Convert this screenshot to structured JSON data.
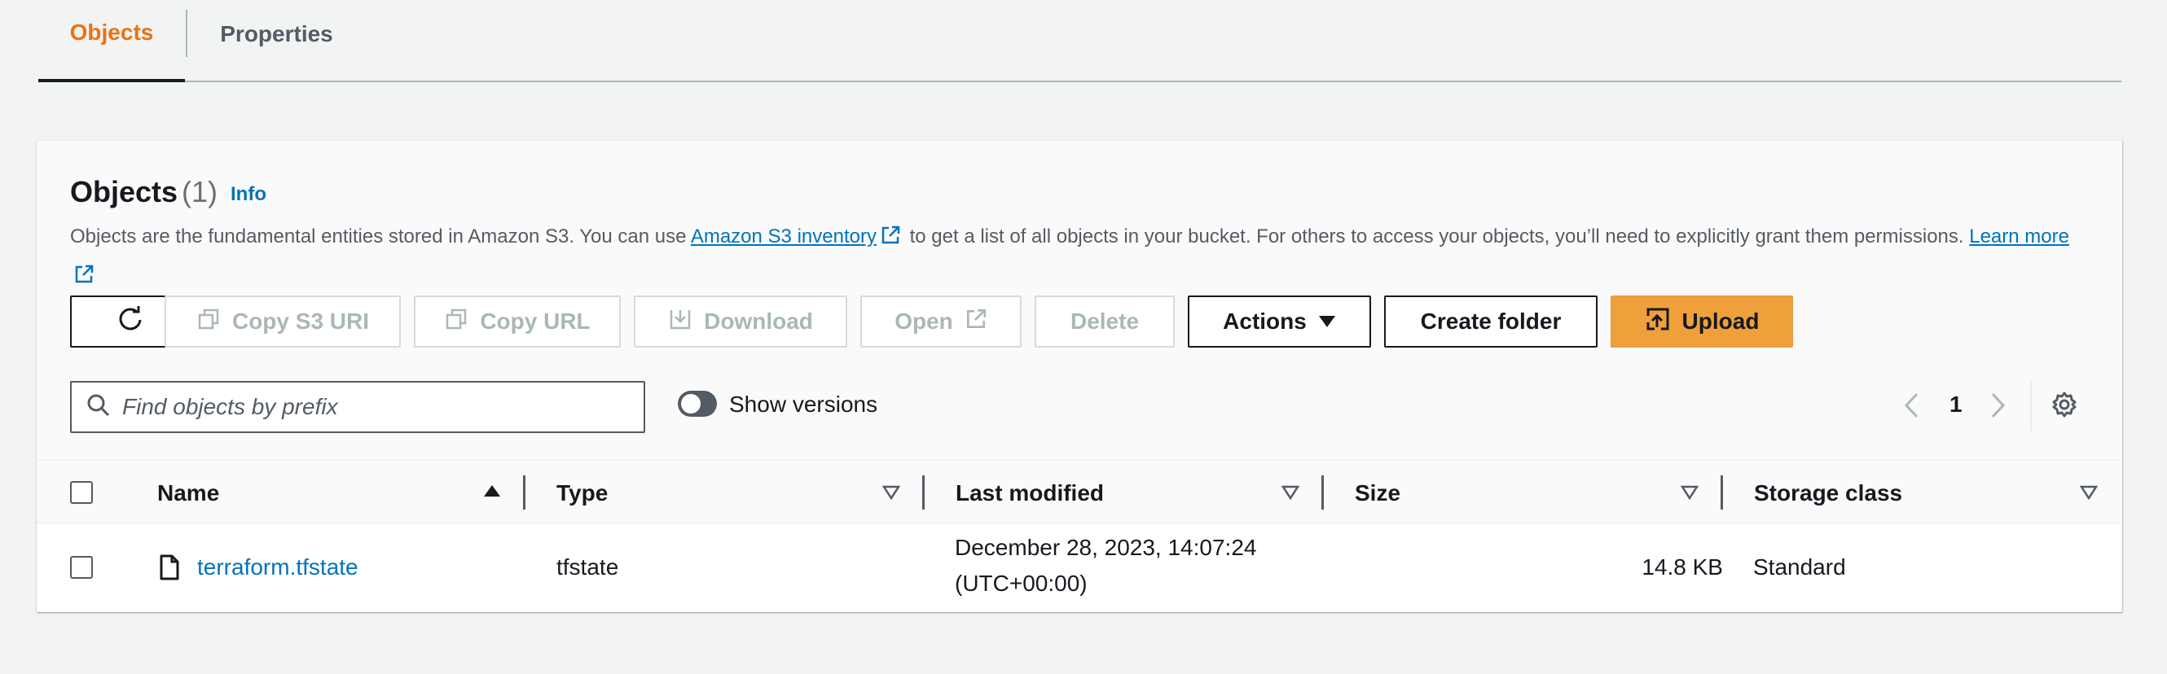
{
  "tabs": [
    {
      "label": "Objects",
      "active": true
    },
    {
      "label": "Properties",
      "active": false
    }
  ],
  "panel": {
    "title": "Objects",
    "count": "(1)",
    "info": "Info",
    "description": {
      "part1": "Objects are the fundamental entities stored in Amazon S3. You can use ",
      "inventory_link": "Amazon S3 inventory",
      "part2": " to get a list of all objects in your bucket. For others to access your objects, you’ll need to explicitly grant them permissions. ",
      "learn_more": "Learn more"
    }
  },
  "toolbar": {
    "copy_s3_uri": "Copy S3 URI",
    "copy_url": "Copy URL",
    "download": "Download",
    "open": "Open",
    "delete": "Delete",
    "actions": "Actions",
    "create_folder": "Create folder",
    "upload": "Upload"
  },
  "search": {
    "placeholder": "Find objects by prefix",
    "value": ""
  },
  "versions_toggle": {
    "label": "Show versions",
    "on": false
  },
  "pagination": {
    "current_page": "1"
  },
  "table": {
    "columns": [
      "Name",
      "Type",
      "Last modified",
      "Size",
      "Storage class"
    ],
    "rows": [
      {
        "name": "terraform.tfstate",
        "type": "tfstate",
        "last_modified_line1": "December 28, 2023, 14:07:24",
        "last_modified_line2": "(UTC+00:00)",
        "size": "14.8 KB",
        "storage_class": "Standard"
      }
    ]
  },
  "colors": {
    "accent_orange": "#ec7211",
    "link_blue": "#0073bb",
    "upload_button": "#f0a03a"
  }
}
